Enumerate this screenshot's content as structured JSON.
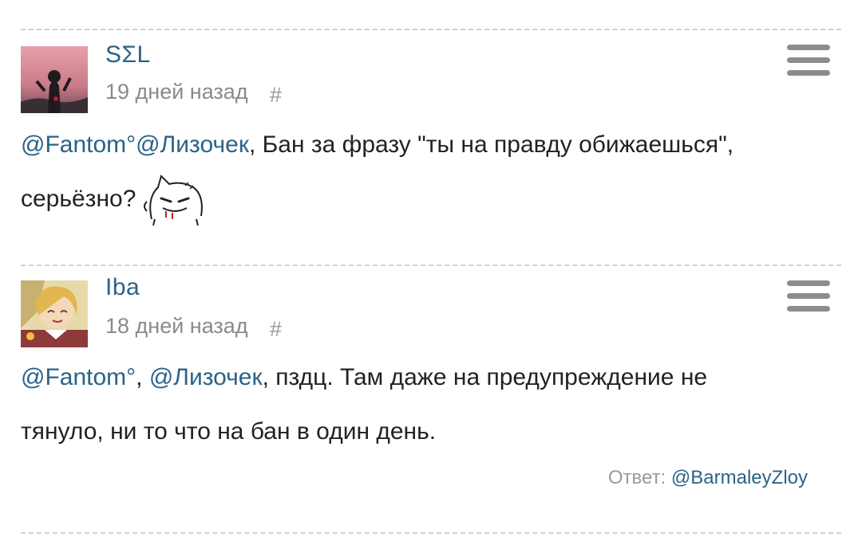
{
  "comments": [
    {
      "username": "SΣL",
      "time": "19 дней назад",
      "hash": "#",
      "mention_1": "@Fantom°",
      "mention_2": "@Лизочек",
      "text_1": ", Бан за фразу \"ты на правду обижаешься\",",
      "text_2": "серьёзно?",
      "emoji": "angry-cat-sticker"
    },
    {
      "username": "Iba",
      "time": "18 дней назад",
      "hash": "#",
      "mention_1": "@Fantom°",
      "separator": ", ",
      "mention_2": "@Лизочек",
      "text_1": ", пздц. Там даже на предупреждение не",
      "text_2": "тянуло, ни то что на бан в один день.",
      "reply_label": "Ответ:",
      "reply_user": "@BarmaleyZloy"
    }
  ],
  "icons": {
    "menu": "hamburger-menu-icon"
  },
  "colors": {
    "link": "#2a6387",
    "muted": "#8a8a8a",
    "divider": "#d0d0d0"
  }
}
